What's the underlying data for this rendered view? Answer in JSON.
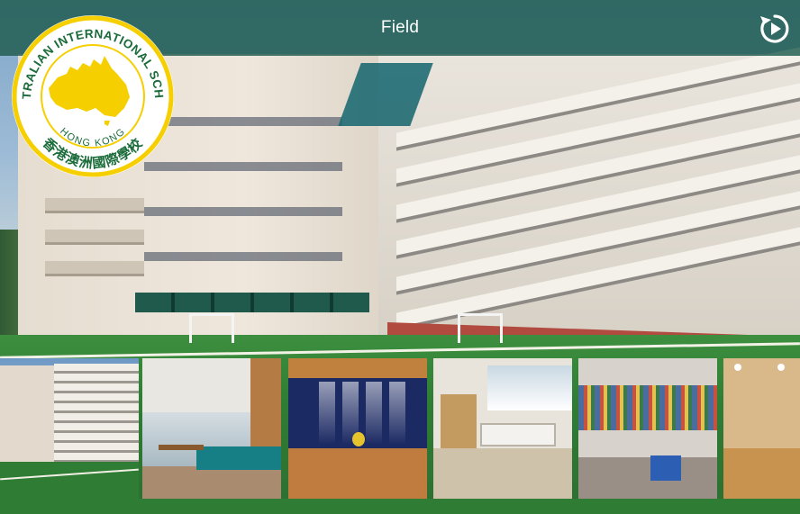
{
  "header": {
    "title": "Field",
    "replay_icon": "replay-icon"
  },
  "logo": {
    "top_text": "AUSTRALIAN INTERNATIONAL SCHOOL",
    "middle_text": "HONG KONG",
    "bottom_text": "香港澳洲國際學校",
    "colors": {
      "ring": "#f6cf00",
      "map": "#f6cf00",
      "text": "#1b6c3a"
    }
  },
  "thumbnails": [
    {
      "scene": "field"
    },
    {
      "scene": "cafeteria"
    },
    {
      "scene": "hall"
    },
    {
      "scene": "classroom"
    },
    {
      "scene": "library"
    },
    {
      "scene": "gymnasium"
    }
  ],
  "colors": {
    "header_bg": "#1f5a4e",
    "title": "#ffffff",
    "field": "#2f7c34",
    "thumb_border": "#3a7d3c"
  }
}
